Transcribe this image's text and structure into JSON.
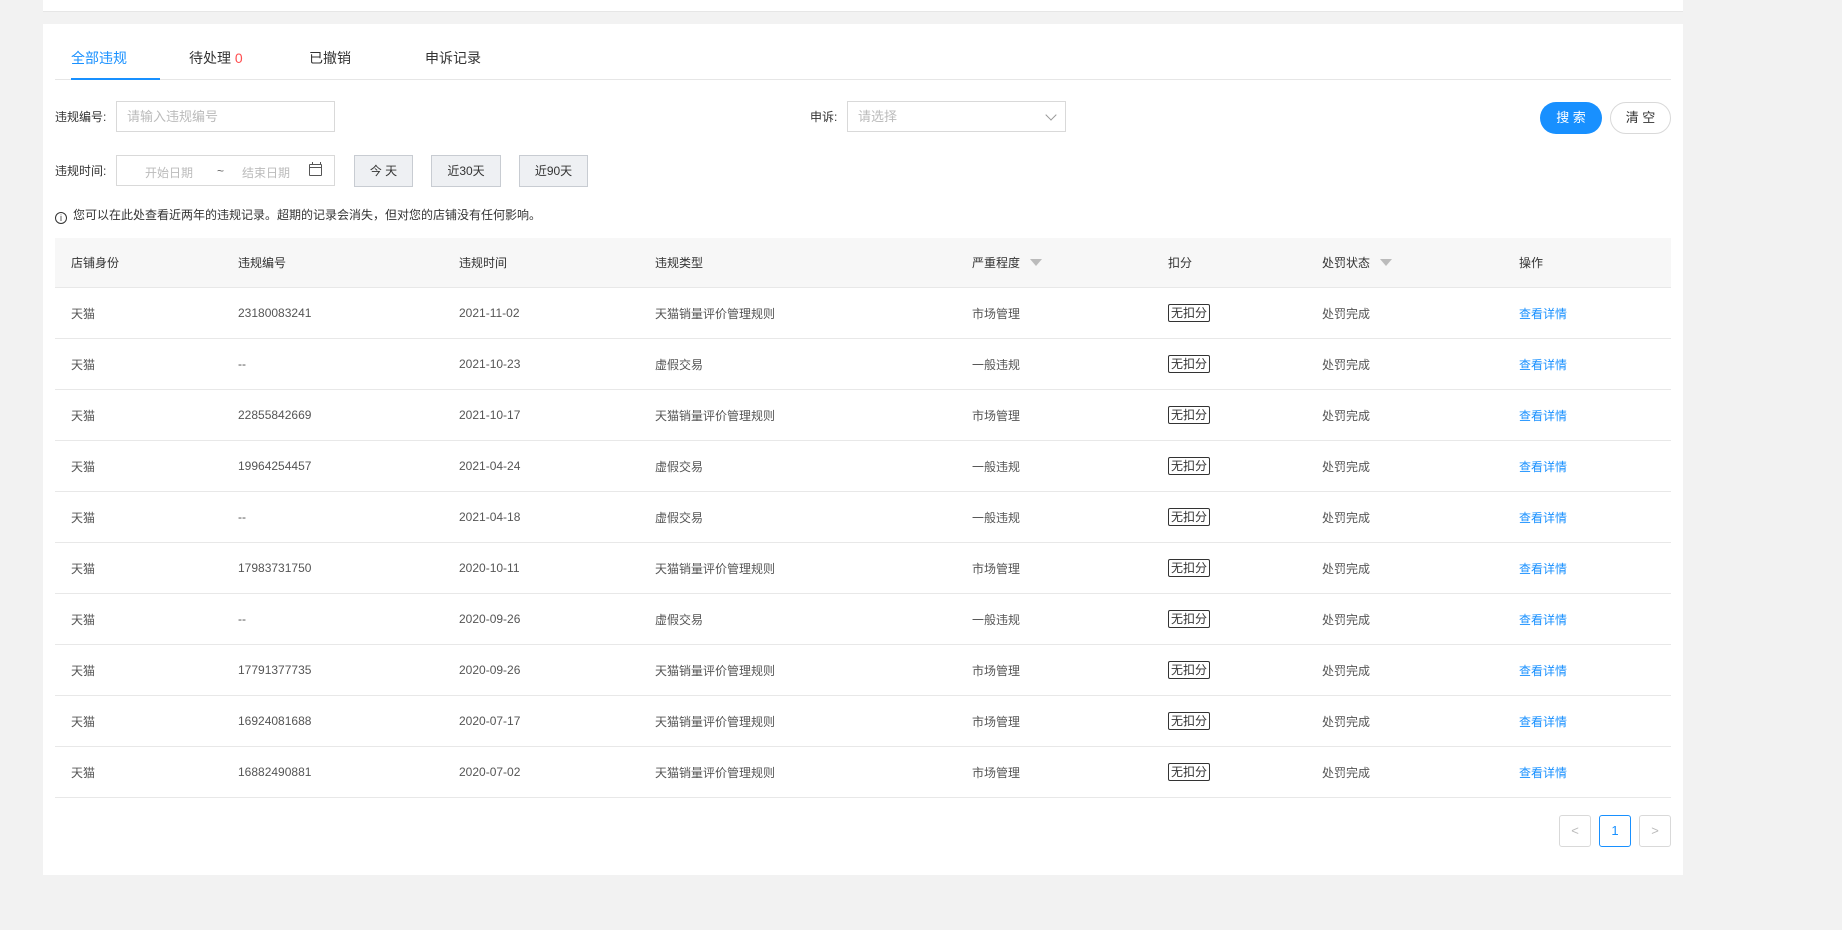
{
  "tabs": [
    {
      "label": "全部违规"
    },
    {
      "label": "待处理",
      "count": "0"
    },
    {
      "label": "已撤销"
    },
    {
      "label": "申诉记录"
    }
  ],
  "filters": {
    "violation_no_label": "违规编号:",
    "violation_no_placeholder": "请输入违规编号",
    "appeal_label": "申诉:",
    "appeal_placeholder": "请选择",
    "time_label": "违规时间:",
    "start_placeholder": "开始日期",
    "range_sep": "~",
    "end_placeholder": "结束日期",
    "quick": [
      "今 天",
      "近30天",
      "近90天"
    ],
    "search_label": "搜 索",
    "clear_label": "清 空"
  },
  "notice": "您可以在此处查看近两年的违规记录。超期的记录会消失，但对您的店铺没有任何影响。",
  "table": {
    "columns": [
      "店铺身份",
      "违规编号",
      "违规时间",
      "违规类型",
      "严重程度",
      "扣分",
      "处罚状态",
      "操作"
    ],
    "rows": [
      [
        "天猫",
        "23180083241",
        "2021-11-02",
        "天猫销量评价管理规则",
        "市场管理",
        "无扣分",
        "处罚完成",
        "查看详情"
      ],
      [
        "天猫",
        "--",
        "2021-10-23",
        "虚假交易",
        "一般违规",
        "无扣分",
        "处罚完成",
        "查看详情"
      ],
      [
        "天猫",
        "22855842669",
        "2021-10-17",
        "天猫销量评价管理规则",
        "市场管理",
        "无扣分",
        "处罚完成",
        "查看详情"
      ],
      [
        "天猫",
        "19964254457",
        "2021-04-24",
        "虚假交易",
        "一般违规",
        "无扣分",
        "处罚完成",
        "查看详情"
      ],
      [
        "天猫",
        "--",
        "2021-04-18",
        "虚假交易",
        "一般违规",
        "无扣分",
        "处罚完成",
        "查看详情"
      ],
      [
        "天猫",
        "17983731750",
        "2020-10-11",
        "天猫销量评价管理规则",
        "市场管理",
        "无扣分",
        "处罚完成",
        "查看详情"
      ],
      [
        "天猫",
        "--",
        "2020-09-26",
        "虚假交易",
        "一般违规",
        "无扣分",
        "处罚完成",
        "查看详情"
      ],
      [
        "天猫",
        "17791377735",
        "2020-09-26",
        "天猫销量评价管理规则",
        "市场管理",
        "无扣分",
        "处罚完成",
        "查看详情"
      ],
      [
        "天猫",
        "16924081688",
        "2020-07-17",
        "天猫销量评价管理规则",
        "市场管理",
        "无扣分",
        "处罚完成",
        "查看详情"
      ],
      [
        "天猫",
        "16882490881",
        "2020-07-02",
        "天猫销量评价管理规则",
        "市场管理",
        "无扣分",
        "处罚完成",
        "查看详情"
      ]
    ]
  },
  "pagination": {
    "prev": "<",
    "current": "1",
    "next": ">"
  },
  "colors": {
    "accent": "#1890ff",
    "count": "#ff4d4f"
  }
}
